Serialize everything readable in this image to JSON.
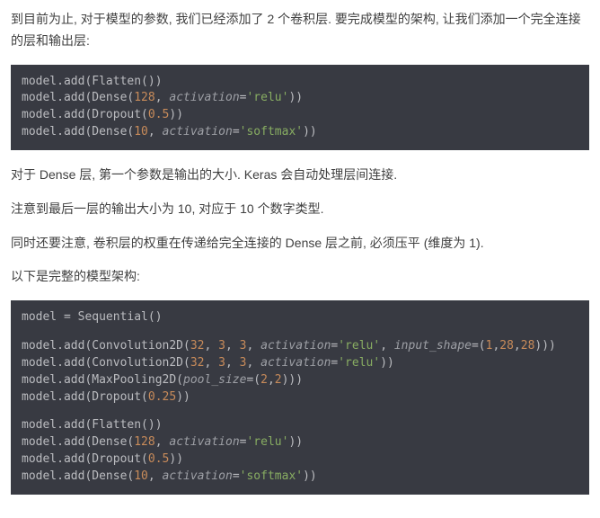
{
  "p1": "到目前为止, 对于模型的参数, 我们已经添加了 2 个卷积层. 要完成模型的架构, 让我们添加一个完全连接的层和输出层:",
  "code1": {
    "l1": {
      "a": "model.add(Flatten())"
    },
    "l2": {
      "a": "model.add(Dense(",
      "b": "128",
      "c": ", ",
      "d": "activation",
      "e": "=",
      "f": "'relu'",
      "g": "))"
    },
    "l3": {
      "a": "model.add(Dropout(",
      "b": "0.5",
      "c": "))"
    },
    "l4": {
      "a": "model.add(Dense(",
      "b": "10",
      "c": ", ",
      "d": "activation",
      "e": "=",
      "f": "'softmax'",
      "g": "))"
    }
  },
  "p2": "对于 Dense 层, 第一个参数是输出的大小. Keras 会自动处理层间连接.",
  "p3": "注意到最后一层的输出大小为 10, 对应于 10 个数字类型.",
  "p4": "同时还要注意, 卷积层的权重在传递给完全连接的 Dense 层之前, 必须压平 (维度为 1).",
  "p5": "以下是完整的模型架构:",
  "code2": {
    "l1": {
      "a": "model = Sequential()"
    },
    "l2": {
      "a": "model.add(Convolution2D(",
      "b": "32",
      "c": ", ",
      "d": "3",
      "e": ", ",
      "f": "3",
      "g": ", ",
      "h": "activation",
      "i": "=",
      "j": "'relu'",
      "k": ", ",
      "l": "input_shape",
      "m": "=(",
      "n": "1",
      "o": ",",
      "p": "28",
      "q": ",",
      "r": "28",
      "s": ")))"
    },
    "l3": {
      "a": "model.add(Convolution2D(",
      "b": "32",
      "c": ", ",
      "d": "3",
      "e": ", ",
      "f": "3",
      "g": ", ",
      "h": "activation",
      "i": "=",
      "j": "'relu'",
      "k": "))"
    },
    "l4": {
      "a": "model.add(MaxPooling2D(",
      "b": "pool_size",
      "c": "=(",
      "d": "2",
      "e": ",",
      "f": "2",
      "g": ")))"
    },
    "l5": {
      "a": "model.add(Dropout(",
      "b": "0.25",
      "c": "))"
    },
    "l6": {
      "a": "model.add(Flatten())"
    },
    "l7": {
      "a": "model.add(Dense(",
      "b": "128",
      "c": ", ",
      "d": "activation",
      "e": "=",
      "f": "'relu'",
      "g": "))"
    },
    "l8": {
      "a": "model.add(Dropout(",
      "b": "0.5",
      "c": "))"
    },
    "l9": {
      "a": "model.add(Dense(",
      "b": "10",
      "c": ", ",
      "d": "activation",
      "e": "=",
      "f": "'softmax'",
      "g": "))"
    }
  }
}
